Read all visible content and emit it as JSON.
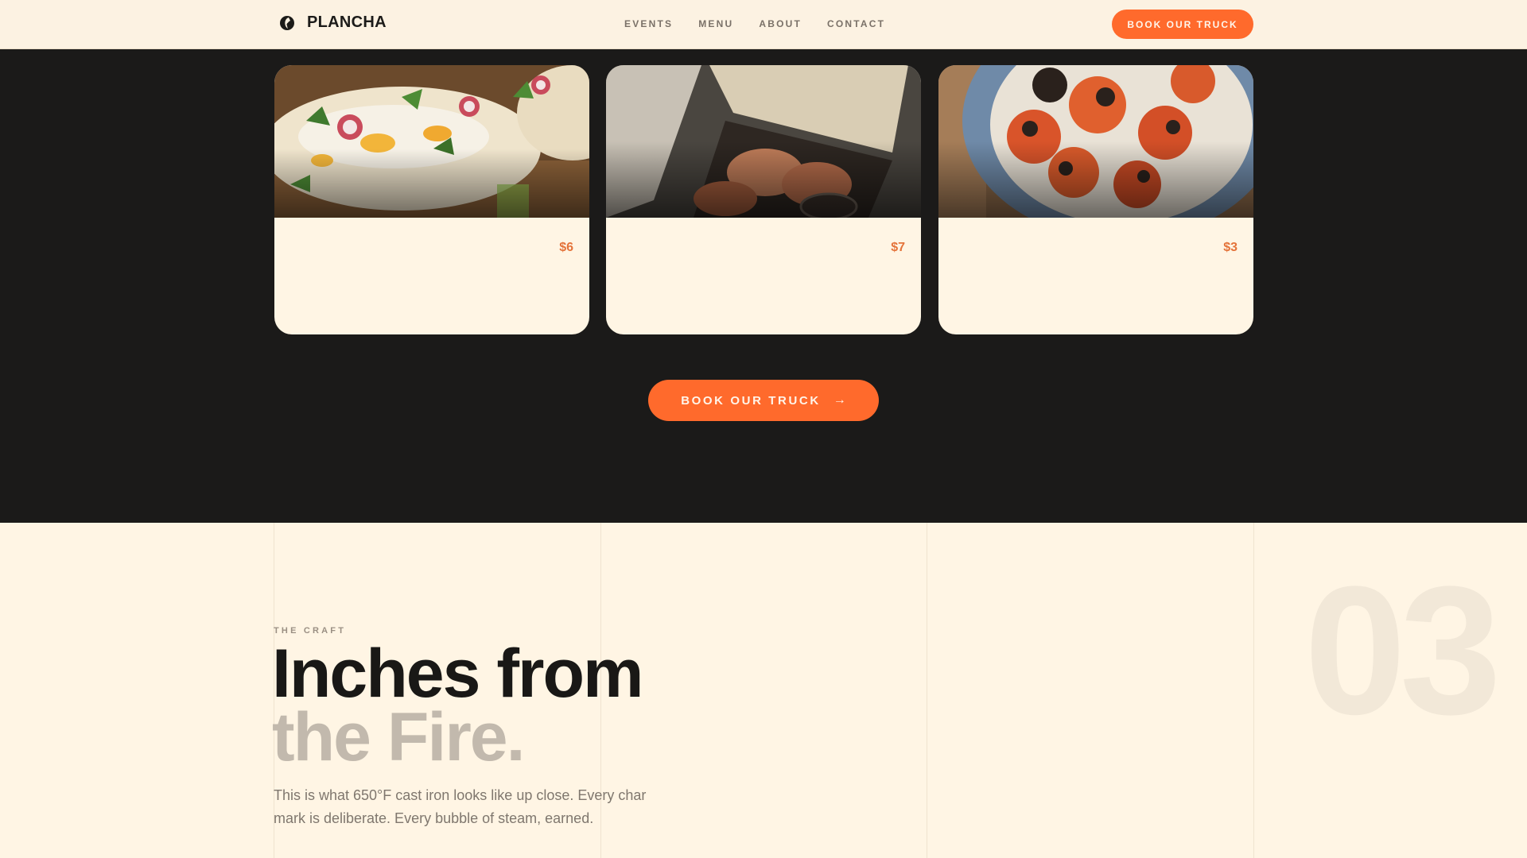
{
  "nav": {
    "brand": "PLANCHA",
    "links": [
      "EVENTS",
      "MENU",
      "ABOUT",
      "CONTACT"
    ],
    "cta_label": "BOOK OUR TRUCK"
  },
  "menu_cards": [
    {
      "price": "$6",
      "photo": "tacos"
    },
    {
      "price": "$7",
      "photo": "churros-box"
    },
    {
      "price": "$3",
      "photo": "charred-tomatoes"
    }
  ],
  "book_button": {
    "label": "BOOK OUR TRUCK",
    "icon": "arrow-right-icon"
  },
  "craft": {
    "section_number": "03",
    "eyebrow": "THE CRAFT",
    "headline_line1": "Inches from",
    "headline_line2": "the Fire.",
    "body": "This is what 650°F cast iron looks like up close. Every char mark is deliberate. Every bubble of steam, earned."
  },
  "colors": {
    "accent": "#ff6a2c",
    "dark_bg": "#1b1a19",
    "cream": "#fff5e4",
    "price": "#e4733a"
  }
}
